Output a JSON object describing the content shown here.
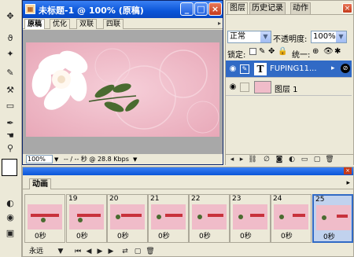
{
  "document_window": {
    "title": "未标题-1 @ 100% (原稿)",
    "tabs": [
      "原稿",
      "优化",
      "双联",
      "四联"
    ],
    "status_zoom": "100%",
    "status_info": "-- / -- 秒 @ 28.8 Kbps"
  },
  "layers_panel": {
    "tabs": [
      "图层",
      "历史记录",
      "动作"
    ],
    "blend_mode": "正常",
    "opacity_label": "不透明度:",
    "opacity_value": "100%",
    "lock_label": "锁定:",
    "unify_label": "统一:",
    "layers": [
      {
        "name": "FUPING11...",
        "type": "text",
        "type_glyph": "T",
        "selected": true
      },
      {
        "name": "图层 1",
        "type": "image",
        "selected": false
      }
    ]
  },
  "animation_panel": {
    "tab": "动画",
    "frames": [
      {
        "number": "",
        "delay": "0秒"
      },
      {
        "number": "19",
        "delay": "0秒"
      },
      {
        "number": "20",
        "delay": "0秒"
      },
      {
        "number": "21",
        "delay": "0秒"
      },
      {
        "number": "22",
        "delay": "0秒"
      },
      {
        "number": "23",
        "delay": "0秒"
      },
      {
        "number": "24",
        "delay": "0秒"
      },
      {
        "number": "25",
        "delay": "0秒",
        "selected": true
      }
    ],
    "loop_option": "永远"
  },
  "colors": {
    "titlebar": "#0a55d8",
    "selection": "#316ac5",
    "canvas_pink": "#f0bcc9",
    "panel_bg": "#ece9d8"
  }
}
